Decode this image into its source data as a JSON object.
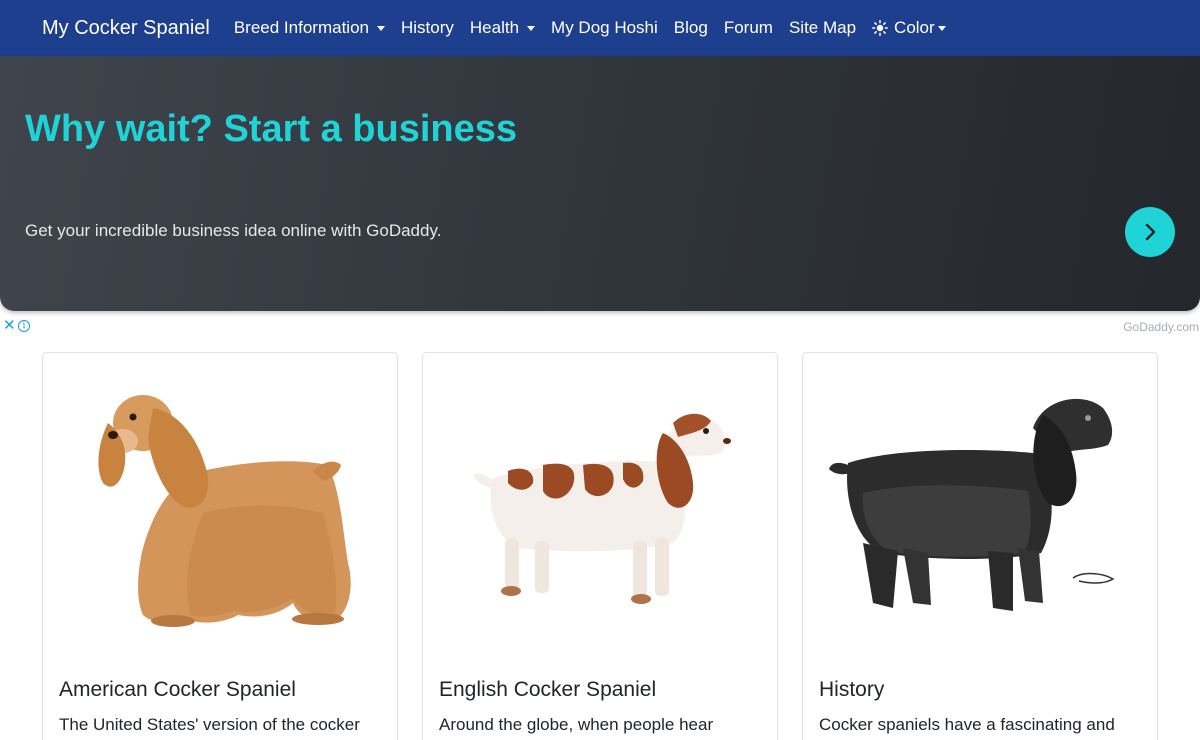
{
  "nav": {
    "brand": "My Cocker Spaniel",
    "items": [
      {
        "label": "Breed Information",
        "dropdown": true
      },
      {
        "label": "History",
        "dropdown": false
      },
      {
        "label": "Health",
        "dropdown": true
      },
      {
        "label": "My Dog Hoshi",
        "dropdown": false
      },
      {
        "label": "Blog",
        "dropdown": false
      },
      {
        "label": "Forum",
        "dropdown": false
      },
      {
        "label": "Site Map",
        "dropdown": false
      },
      {
        "label": "Color",
        "dropdown": true,
        "icon": "sun-icon"
      }
    ]
  },
  "ad": {
    "headline": "Why wait? Start a business",
    "body": "Get your incredible business idea online with GoDaddy.",
    "close_glyph": "✕",
    "info_glyph": "i",
    "source": "GoDaddy.com",
    "accent_color": "#1fd3d6"
  },
  "cards": [
    {
      "title": "American Cocker Spaniel",
      "text": "The United States' version of the cocker",
      "image": "golden-cocker-spaniel-photo"
    },
    {
      "title": "English Cocker Spaniel",
      "text": "Around the globe, when people hear",
      "image": "liver-white-cocker-spaniel-photo"
    },
    {
      "title": "History",
      "text": "Cocker spaniels have a fascinating and",
      "image": "black-cocker-spaniel-sketch"
    }
  ],
  "colors": {
    "navbar": "#1d3f8e",
    "ad_background": "#32373e"
  }
}
